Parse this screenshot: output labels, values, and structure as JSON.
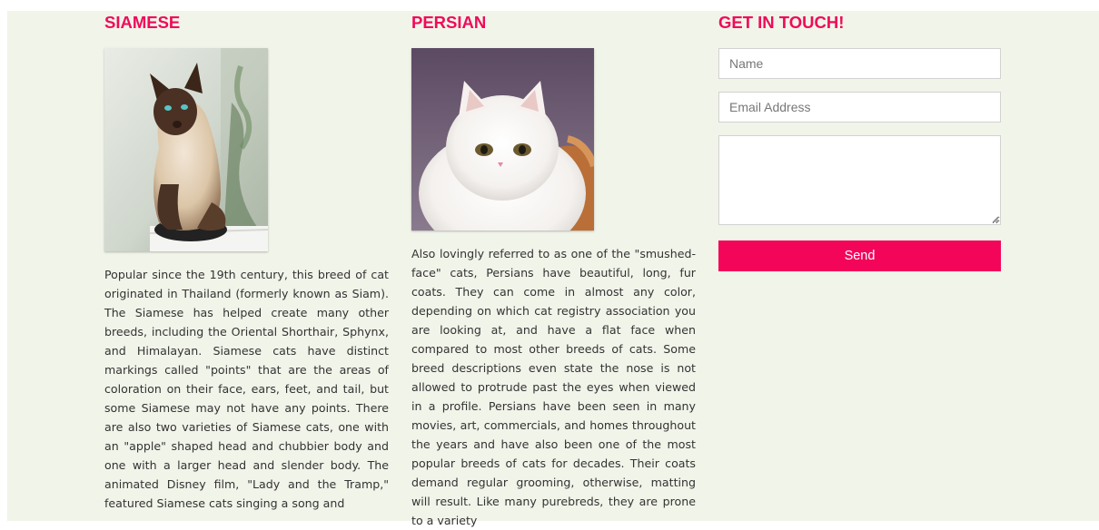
{
  "siamese": {
    "heading": "SIAMESE",
    "image_alt": "siamese-cat-photo",
    "description": "Popular since the 19th century, this breed of cat originated in Thailand (formerly known as Siam). The Siamese has helped create many other breeds, including the Oriental Shorthair, Sphynx, and Himalayan. Siamese cats have distinct markings called \"points\" that are the areas of coloration on their face, ears, feet, and tail, but some Siamese may not have any points. There are also two varieties of Siamese cats, one with an \"apple\" shaped head and chubbier body and one with a larger head and slender body. The animated Disney film, \"Lady and the Tramp,\" featured Siamese cats singing a song and"
  },
  "persian": {
    "heading": "PERSIAN",
    "image_alt": "persian-cat-photo",
    "description": "Also lovingly referred to as one of the \"smushed-face\" cats, Persians have beautiful, long, fur coats. They can come in almost any color, depending on which cat registry association you are looking at, and have a flat face when compared to most other breeds of cats. Some breed descriptions even state the nose is not allowed to protrude past the eyes when viewed in a profile. Persians have been seen in many movies, art, commercials, and homes throughout the years and have also been one of the most popular breeds of cats for decades. Their coats demand regular grooming, otherwise, matting will result. Like many purebreds, they are prone to a variety"
  },
  "contact": {
    "heading": "GET IN TOUCH!",
    "name_placeholder": "Name",
    "email_placeholder": "Email Address",
    "message_placeholder": "",
    "send_label": "Send"
  },
  "colors": {
    "accent": "#f3055a",
    "heading": "#f00a5a",
    "background": "#f1f4e9"
  }
}
